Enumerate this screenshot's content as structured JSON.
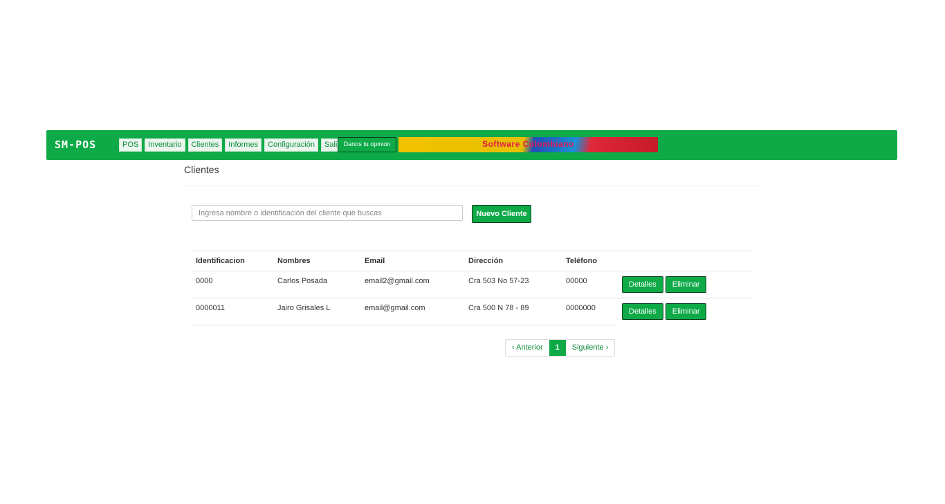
{
  "navbar": {
    "brand": "SM-POS",
    "menu": [
      "POS",
      "Inventario",
      "Clientes",
      "Informes",
      "Configuración",
      "Salir"
    ],
    "feedback_label": "Danos tu opinion",
    "banner_text": "Software Colombiano",
    "color": "#0daa47"
  },
  "page": {
    "title": "Clientes"
  },
  "search": {
    "placeholder": "Ingresa nombre o identificación del cliente que buscas",
    "value": ""
  },
  "new_client_label": "Nuevo Cliente",
  "table": {
    "headers": [
      "Identificacion",
      "Nombres",
      "Email",
      "Dirección",
      "Teléfono"
    ],
    "rows": [
      {
        "id": "0000",
        "name": "Carlos Posada",
        "email": "email2@gmail.com",
        "address": "Cra 503 No 57-23",
        "phone": "00000"
      },
      {
        "id": "0000011",
        "name": "Jairo Grisales L",
        "email": "email@gmail.com",
        "address": "Cra 500 N 78 - 89",
        "phone": "0000000"
      }
    ],
    "details_label": "Detalles",
    "delete_label": "Eliminar"
  },
  "pagination": {
    "prev": "‹ Anterior",
    "current": "1",
    "next": "Siguiente ›"
  }
}
